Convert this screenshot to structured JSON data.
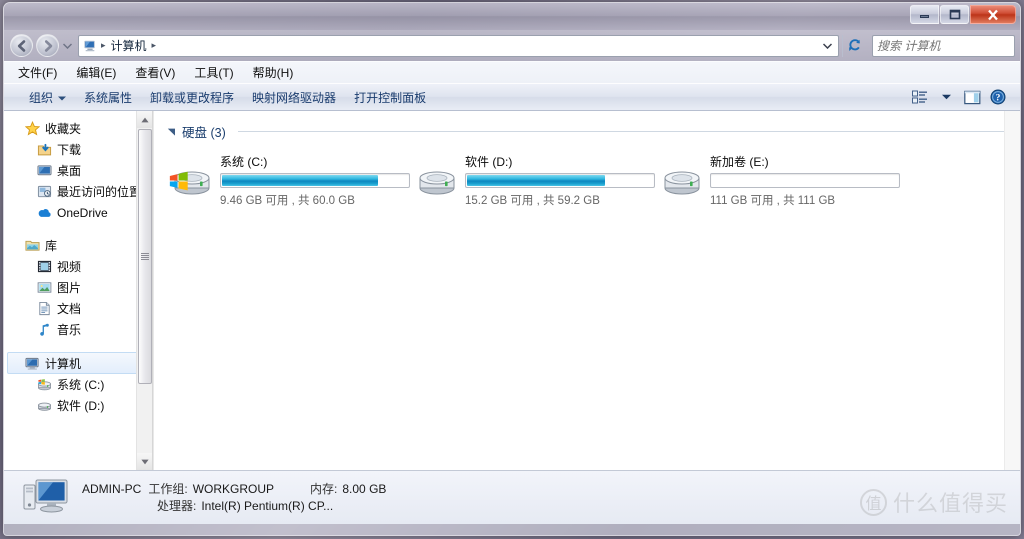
{
  "window": {
    "buttons": {
      "minimize": "minimize-button",
      "maximize": "maximize-button",
      "close": "close-button"
    }
  },
  "address": {
    "crumb_icon": "computer-icon",
    "crumb": "计算机",
    "separator": "▸"
  },
  "search": {
    "placeholder": "搜索 计算机",
    "value": ""
  },
  "menu": {
    "items": [
      {
        "label": "文件(F)",
        "name": "menu-file"
      },
      {
        "label": "编辑(E)",
        "name": "menu-edit"
      },
      {
        "label": "查看(V)",
        "name": "menu-view"
      },
      {
        "label": "工具(T)",
        "name": "menu-tools"
      },
      {
        "label": "帮助(H)",
        "name": "menu-help"
      }
    ]
  },
  "commandbar": {
    "items": [
      {
        "label": "组织",
        "name": "organize-button",
        "dropdown": true
      },
      {
        "label": "系统属性",
        "name": "system-properties-button",
        "dropdown": false
      },
      {
        "label": "卸载或更改程序",
        "name": "uninstall-change-program-button",
        "dropdown": false
      },
      {
        "label": "映射网络驱动器",
        "name": "map-network-drive-button",
        "dropdown": false
      },
      {
        "label": "打开控制面板",
        "name": "open-control-panel-button",
        "dropdown": false
      }
    ],
    "right_icons": [
      "view-options-icon",
      "chevron-down-icon",
      "preview-pane-icon",
      "help-icon"
    ]
  },
  "navpane": {
    "groups": [
      {
        "header": {
          "label": "收藏夹",
          "icon": "star-icon"
        },
        "children": [
          {
            "label": "下载",
            "icon": "downloads-icon"
          },
          {
            "label": "桌面",
            "icon": "desktop-icon"
          },
          {
            "label": "最近访问的位置",
            "icon": "recent-places-icon"
          },
          {
            "label": "OneDrive",
            "icon": "onedrive-icon"
          }
        ]
      },
      {
        "header": {
          "label": "库",
          "icon": "library-icon"
        },
        "children": [
          {
            "label": "视频",
            "icon": "videos-icon"
          },
          {
            "label": "图片",
            "icon": "pictures-icon"
          },
          {
            "label": "文档",
            "icon": "documents-icon"
          },
          {
            "label": "音乐",
            "icon": "music-icon"
          }
        ]
      },
      {
        "header": {
          "label": "计算机",
          "icon": "computer-icon",
          "selected": true
        },
        "children": [
          {
            "label": "系统 (C:)",
            "icon": "system-drive-icon"
          },
          {
            "label": "软件 (D:)",
            "icon": "drive-icon"
          }
        ]
      }
    ]
  },
  "content": {
    "group": {
      "title": "硬盘 (3)",
      "expanded": true
    },
    "drives": [
      {
        "name": "系统 (C:)",
        "free": "9.46 GB 可用 , 共 60.0 GB",
        "used_percent": 84,
        "bar_color": "#1aa0cf",
        "icon": "system-drive-icon"
      },
      {
        "name": "软件 (D:)",
        "free": "15.2 GB 可用 , 共 59.2 GB",
        "used_percent": 74,
        "bar_color": "#1aa0cf",
        "icon": "drive-icon"
      },
      {
        "name": "新加卷 (E:)",
        "free": "111 GB 可用 , 共 111 GB",
        "used_percent": 0,
        "bar_color": "#1aa0cf",
        "icon": "drive-icon"
      }
    ]
  },
  "details": {
    "icon": "computer-large-icon",
    "computer_name": "ADMIN-PC",
    "workgroup_label": "工作组:",
    "workgroup_value": "WORKGROUP",
    "memory_label": "内存:",
    "memory_value": "8.00 GB",
    "processor_label": "处理器:",
    "processor_value": "Intel(R) Pentium(R) CP..."
  },
  "watermark": {
    "badge": "值",
    "text": "什么值得买"
  }
}
